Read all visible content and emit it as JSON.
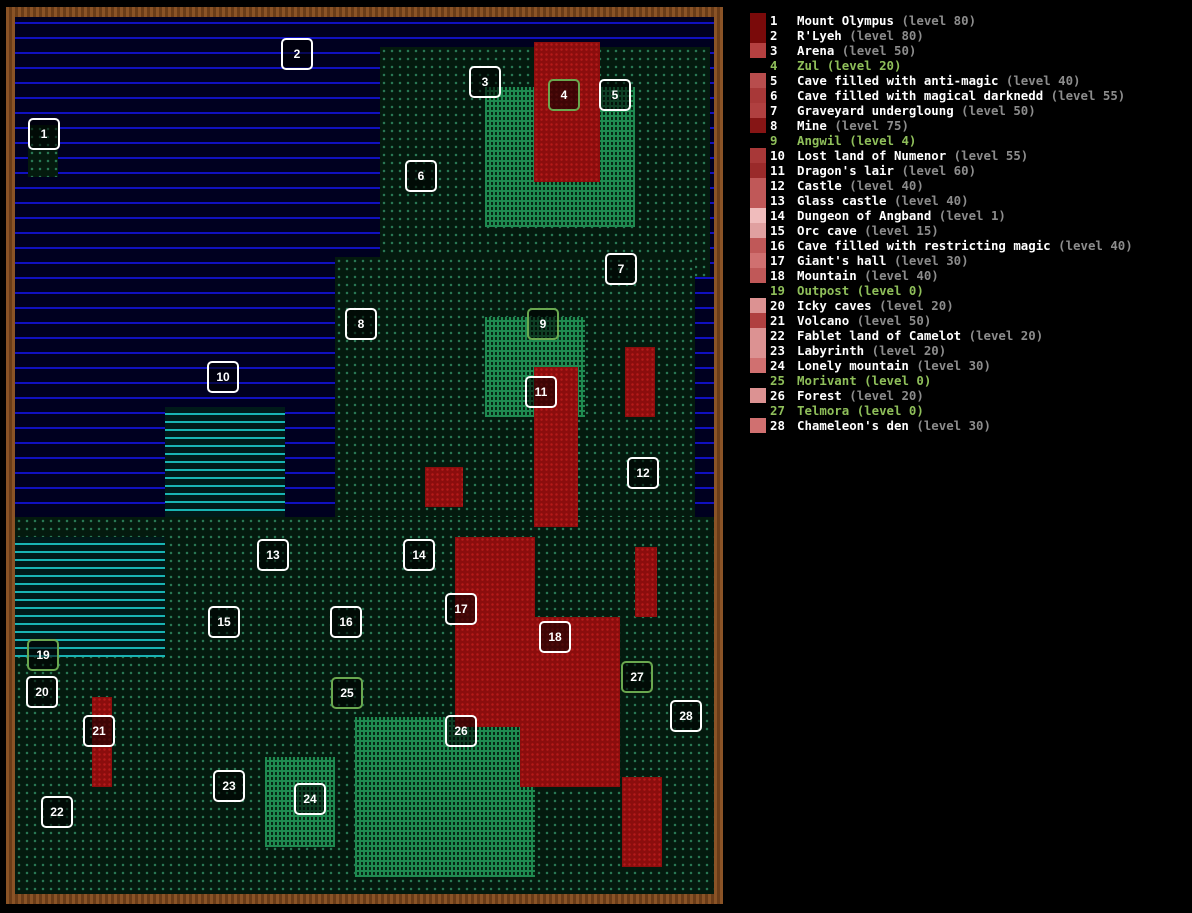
{
  "map": {
    "locations": [
      {
        "id": "1",
        "kind": "dungeon"
      },
      {
        "id": "2",
        "kind": "dungeon"
      },
      {
        "id": "3",
        "kind": "dungeon"
      },
      {
        "id": "4",
        "kind": "town"
      },
      {
        "id": "5",
        "kind": "dungeon"
      },
      {
        "id": "6",
        "kind": "dungeon"
      },
      {
        "id": "7",
        "kind": "dungeon"
      },
      {
        "id": "8",
        "kind": "dungeon"
      },
      {
        "id": "9",
        "kind": "town"
      },
      {
        "id": "10",
        "kind": "dungeon"
      },
      {
        "id": "11",
        "kind": "dungeon"
      },
      {
        "id": "12",
        "kind": "dungeon"
      },
      {
        "id": "13",
        "kind": "dungeon"
      },
      {
        "id": "14",
        "kind": "dungeon"
      },
      {
        "id": "15",
        "kind": "dungeon"
      },
      {
        "id": "16",
        "kind": "dungeon"
      },
      {
        "id": "17",
        "kind": "dungeon"
      },
      {
        "id": "18",
        "kind": "dungeon"
      },
      {
        "id": "19",
        "kind": "town"
      },
      {
        "id": "20",
        "kind": "dungeon"
      },
      {
        "id": "21",
        "kind": "dungeon"
      },
      {
        "id": "22",
        "kind": "dungeon"
      },
      {
        "id": "23",
        "kind": "dungeon"
      },
      {
        "id": "24",
        "kind": "dungeon"
      },
      {
        "id": "25",
        "kind": "town"
      },
      {
        "id": "26",
        "kind": "dungeon"
      },
      {
        "id": "27",
        "kind": "town"
      },
      {
        "id": "28",
        "kind": "dungeon"
      }
    ]
  },
  "legend": {
    "items": [
      {
        "num": "1",
        "name": "Mount Olympus",
        "level": "(level 80)",
        "town": false,
        "swatch": "#7a0a0a"
      },
      {
        "num": "2",
        "name": "R'Lyeh",
        "level": "(level 80)",
        "town": false,
        "swatch": "#7a0a0a"
      },
      {
        "num": "3",
        "name": "Arena",
        "level": "(level 50)",
        "town": false,
        "swatch": "#b54040"
      },
      {
        "num": "4",
        "name": "Zul",
        "level": "(level 20)",
        "town": true,
        "swatch": "#000000"
      },
      {
        "num": "5",
        "name": "Cave filled with anti-magic",
        "level": "(level 40)",
        "town": false,
        "swatch": "#b84d4d"
      },
      {
        "num": "6",
        "name": "Cave filled with magical darknedd",
        "level": "(level 55)",
        "town": false,
        "swatch": "#a83838"
      },
      {
        "num": "7",
        "name": "Graveyard undergloung",
        "level": "(level 50)",
        "town": false,
        "swatch": "#b04040"
      },
      {
        "num": "8",
        "name": "Mine",
        "level": "(level 75)",
        "town": false,
        "swatch": "#861515"
      },
      {
        "num": "9",
        "name": "Angwil",
        "level": "(level 4)",
        "town": true,
        "swatch": "#000000"
      },
      {
        "num": "10",
        "name": "Lost land of Numenor",
        "level": "(level 55)",
        "town": false,
        "swatch": "#a83838"
      },
      {
        "num": "11",
        "name": "Dragon's lair",
        "level": "(level 60)",
        "town": false,
        "swatch": "#9a2a2a"
      },
      {
        "num": "12",
        "name": "Castle",
        "level": "(level 40)",
        "town": false,
        "swatch": "#c05858"
      },
      {
        "num": "13",
        "name": "Glass castle",
        "level": "(level 40)",
        "town": false,
        "swatch": "#c05858"
      },
      {
        "num": "14",
        "name": "Dungeon of Angband",
        "level": "(level 1)",
        "town": false,
        "swatch": "#f0bcbc"
      },
      {
        "num": "15",
        "name": "Orc cave",
        "level": "(level 15)",
        "town": false,
        "swatch": "#e0a0a0"
      },
      {
        "num": "16",
        "name": "Cave filled with restricting magic",
        "level": "(level 40)",
        "town": false,
        "swatch": "#c05858"
      },
      {
        "num": "17",
        "name": "Giant's hall",
        "level": "(level 30)",
        "town": false,
        "swatch": "#d07070"
      },
      {
        "num": "18",
        "name": "Mountain",
        "level": "(level 40)",
        "town": false,
        "swatch": "#c05858"
      },
      {
        "num": "19",
        "name": "Outpost",
        "level": "(level 0)",
        "town": true,
        "swatch": "#000000"
      },
      {
        "num": "20",
        "name": "Icky caves",
        "level": "(level 20)",
        "town": false,
        "swatch": "#dc9292"
      },
      {
        "num": "21",
        "name": "Volcano",
        "level": "(level 50)",
        "town": false,
        "swatch": "#b04040"
      },
      {
        "num": "22",
        "name": "Fablet land of Camelot",
        "level": "(level 20)",
        "town": false,
        "swatch": "#dc9292"
      },
      {
        "num": "23",
        "name": "Labyrinth",
        "level": "(level 20)",
        "town": false,
        "swatch": "#dc9292"
      },
      {
        "num": "24",
        "name": "Lonely mountain",
        "level": "(level 30)",
        "town": false,
        "swatch": "#d07070"
      },
      {
        "num": "25",
        "name": "Morivant",
        "level": "(level 0)",
        "town": true,
        "swatch": "#000000"
      },
      {
        "num": "26",
        "name": "Forest",
        "level": "(level 20)",
        "town": false,
        "swatch": "#dc9292"
      },
      {
        "num": "27",
        "name": "Telmora",
        "level": "(level 0)",
        "town": true,
        "swatch": "#000000"
      },
      {
        "num": "28",
        "name": "Chameleon's den",
        "level": "(level 30)",
        "town": false,
        "swatch": "#d07070"
      }
    ]
  }
}
